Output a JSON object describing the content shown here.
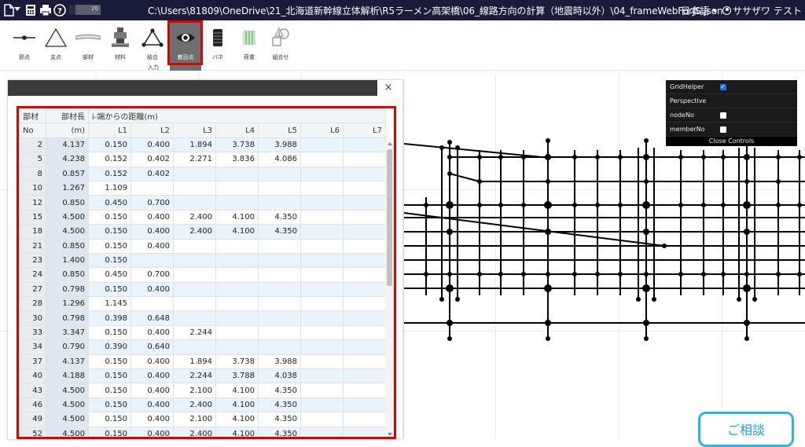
{
  "titlebar": {
    "slider_value": "20",
    "file_path": "C:\\Users\\81809\\OneDrive\\21_北海道新幹線立体解析\\R5ラーメン高架橋\\06_線路方向の計算（地震時以外）\\04_frameWebForJS.json",
    "language": "日本語",
    "user_name": "ササザワ テスト",
    "icons": [
      "file-icon",
      "calculator-icon",
      "print-icon",
      "help-icon"
    ]
  },
  "toolbar": {
    "tools": [
      {
        "label": "節点",
        "icon": "node-icon"
      },
      {
        "label": "支点",
        "icon": "support-icon"
      },
      {
        "label": "部材",
        "icon": "member-icon"
      },
      {
        "label": "材料",
        "icon": "material-icon"
      },
      {
        "label": "結合",
        "icon": "joint-icon"
      },
      {
        "label": "着目点",
        "icon": "eye-icon",
        "active": true
      },
      {
        "label": "バネ",
        "icon": "spring-icon"
      },
      {
        "label": "荷重",
        "icon": "load-icon"
      },
      {
        "label": "組合せ",
        "icon": "combine-icon"
      }
    ],
    "group_label": "入力"
  },
  "gui": {
    "rows": [
      {
        "label": "GridHelper",
        "checked": true
      },
      {
        "label": "Perspective",
        "checked": null
      },
      {
        "label": "nodeNo",
        "checked": false
      },
      {
        "label": "memberNo",
        "checked": false
      }
    ],
    "close_label": "Close Controls"
  },
  "panel": {
    "close_symbol": "×",
    "headers": {
      "member_no": "部材",
      "member_no_2": "No",
      "member_length": "部材長",
      "member_length_unit": "(m)",
      "distance_group": "i-端からの距離(m)",
      "distance_cols": [
        "L1",
        "L2",
        "L3",
        "L4",
        "L5",
        "L6",
        "L7"
      ]
    },
    "rows": [
      {
        "no": "2",
        "len": "4.137",
        "d": [
          "0.150",
          "0.400",
          "1.894",
          "3.738",
          "3.988",
          "",
          ""
        ]
      },
      {
        "no": "5",
        "len": "4.238",
        "d": [
          "0.152",
          "0.402",
          "2.271",
          "3.836",
          "4.086",
          "",
          ""
        ]
      },
      {
        "no": "8",
        "len": "0.857",
        "d": [
          "0.152",
          "0.402",
          "",
          "",
          "",
          "",
          ""
        ]
      },
      {
        "no": "10",
        "len": "1.267",
        "d": [
          "1.109",
          "",
          "",
          "",
          "",
          "",
          ""
        ]
      },
      {
        "no": "12",
        "len": "0.850",
        "d": [
          "0.450",
          "0.700",
          "",
          "",
          "",
          "",
          ""
        ]
      },
      {
        "no": "15",
        "len": "4.500",
        "d": [
          "0.150",
          "0.400",
          "2.400",
          "4.100",
          "4.350",
          "",
          ""
        ]
      },
      {
        "no": "18",
        "len": "4.500",
        "d": [
          "0.150",
          "0.400",
          "2.400",
          "4.100",
          "4.350",
          "",
          ""
        ]
      },
      {
        "no": "21",
        "len": "0.850",
        "d": [
          "0.150",
          "0.400",
          "",
          "",
          "",
          "",
          ""
        ]
      },
      {
        "no": "23",
        "len": "1.400",
        "d": [
          "0.150",
          "",
          "",
          "",
          "",
          "",
          ""
        ]
      },
      {
        "no": "24",
        "len": "0.850",
        "d": [
          "0.450",
          "0.700",
          "",
          "",
          "",
          "",
          ""
        ]
      },
      {
        "no": "27",
        "len": "0.798",
        "d": [
          "0.150",
          "0.400",
          "",
          "",
          "",
          "",
          ""
        ]
      },
      {
        "no": "28",
        "len": "1.296",
        "d": [
          "1.145",
          "",
          "",
          "",
          "",
          "",
          ""
        ]
      },
      {
        "no": "30",
        "len": "0.798",
        "d": [
          "0.398",
          "0.648",
          "",
          "",
          "",
          "",
          ""
        ]
      },
      {
        "no": "33",
        "len": "3.347",
        "d": [
          "0.150",
          "0.400",
          "2.244",
          "",
          "",
          "",
          ""
        ]
      },
      {
        "no": "34",
        "len": "0.790",
        "d": [
          "0.390",
          "0.640",
          "",
          "",
          "",
          "",
          ""
        ]
      },
      {
        "no": "37",
        "len": "4.137",
        "d": [
          "0.150",
          "0.400",
          "1.894",
          "3.738",
          "3.988",
          "",
          ""
        ]
      },
      {
        "no": "40",
        "len": "4.188",
        "d": [
          "0.150",
          "0.400",
          "2.244",
          "3.788",
          "4.038",
          "",
          ""
        ]
      },
      {
        "no": "43",
        "len": "4.500",
        "d": [
          "0.150",
          "0.400",
          "2.100",
          "4.100",
          "4.350",
          "",
          ""
        ]
      },
      {
        "no": "46",
        "len": "4.500",
        "d": [
          "0.150",
          "0.400",
          "2.400",
          "4.100",
          "4.350",
          "",
          ""
        ]
      },
      {
        "no": "49",
        "len": "4.500",
        "d": [
          "0.150",
          "0.400",
          "2.100",
          "4.100",
          "4.350",
          "",
          ""
        ]
      },
      {
        "no": "52",
        "len": "4.500",
        "d": [
          "0.150",
          "0.400",
          "2.400",
          "4.100",
          "4.350",
          "",
          ""
        ]
      }
    ]
  },
  "consult_button": "ご相談",
  "colors": {
    "titlebar_bg": "#1b1c3a",
    "highlight": "#e00000",
    "active_tool_bg": "#6f6f6f",
    "row_stripe": "#eaf3fb",
    "consult_accent": "#29b6e6"
  }
}
